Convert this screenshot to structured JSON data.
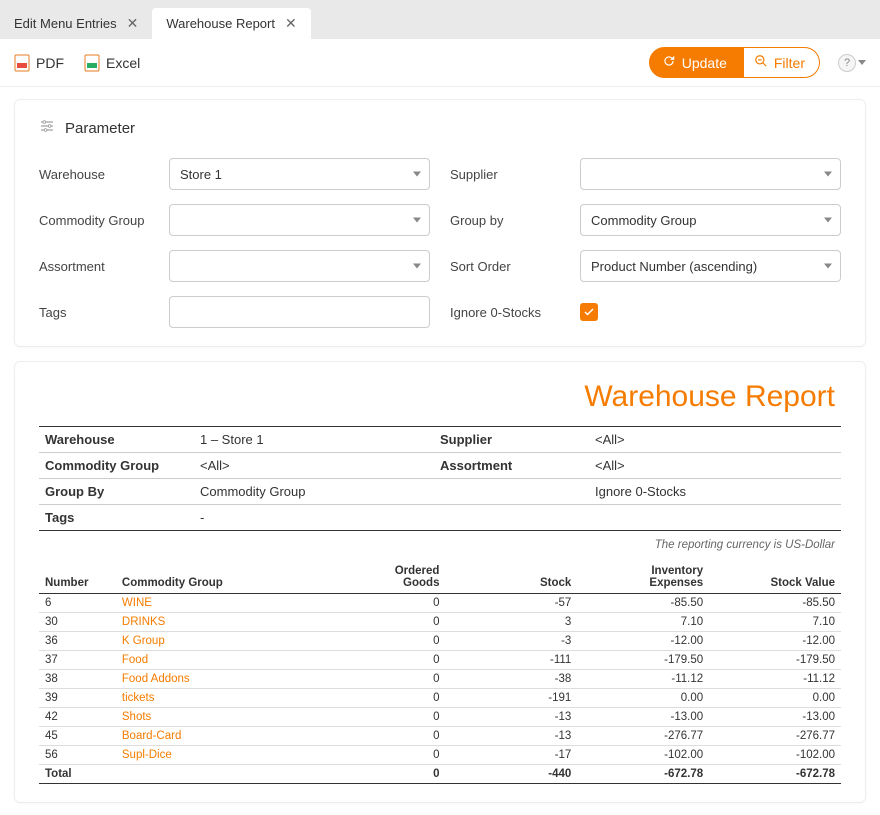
{
  "tabs": [
    {
      "label": "Edit Menu Entries",
      "active": false
    },
    {
      "label": "Warehouse Report",
      "active": true
    }
  ],
  "toolbar": {
    "pdf": "PDF",
    "excel": "Excel",
    "update": "Update",
    "filter": "Filter",
    "help": "?"
  },
  "parameter": {
    "header": "Parameter",
    "labels": {
      "warehouse": "Warehouse",
      "supplier": "Supplier",
      "commodity_group": "Commodity Group",
      "group_by": "Group by",
      "assortment": "Assortment",
      "sort_order": "Sort Order",
      "tags": "Tags",
      "ignore_zero": "Ignore 0-Stocks"
    },
    "values": {
      "warehouse": "Store 1",
      "supplier": "",
      "commodity_group": "",
      "group_by": "Commodity Group",
      "assortment": "",
      "sort_order": "Product Number (ascending)",
      "tags": "",
      "ignore_zero": true
    }
  },
  "report": {
    "title": "Warehouse Report",
    "meta": {
      "warehouse_label": "Warehouse",
      "warehouse_value": "1 – Store 1",
      "supplier_label": "Supplier",
      "supplier_value": "<All>",
      "cg_label": "Commodity Group",
      "cg_value": "<All>",
      "assort_label": "Assortment",
      "assort_value": "<All>",
      "groupby_label": "Group By",
      "groupby_value": "Commodity Group",
      "ignore_label": "",
      "ignore_value": "Ignore 0-Stocks",
      "tags_label": "Tags",
      "tags_value": "-"
    },
    "currency_note": "The reporting currency is US-Dollar",
    "columns": {
      "number": "Number",
      "cg": "Commodity Group",
      "ordered1": "Ordered",
      "ordered2": "Goods",
      "stock": "Stock",
      "inv1": "Inventory",
      "inv2": "Expenses",
      "stock_value": "Stock Value"
    },
    "rows": [
      {
        "number": "6",
        "cg": "WINE",
        "ordered": "0",
        "stock": "-57",
        "inv": "-85.50",
        "sv": "-85.50"
      },
      {
        "number": "30",
        "cg": "DRINKS",
        "ordered": "0",
        "stock": "3",
        "inv": "7.10",
        "sv": "7.10"
      },
      {
        "number": "36",
        "cg": "K Group",
        "ordered": "0",
        "stock": "-3",
        "inv": "-12.00",
        "sv": "-12.00"
      },
      {
        "number": "37",
        "cg": "Food",
        "ordered": "0",
        "stock": "-111",
        "inv": "-179.50",
        "sv": "-179.50"
      },
      {
        "number": "38",
        "cg": "Food Addons",
        "ordered": "0",
        "stock": "-38",
        "inv": "-11.12",
        "sv": "-11.12"
      },
      {
        "number": "39",
        "cg": "tickets",
        "ordered": "0",
        "stock": "-191",
        "inv": "0.00",
        "sv": "0.00"
      },
      {
        "number": "42",
        "cg": "Shots",
        "ordered": "0",
        "stock": "-13",
        "inv": "-13.00",
        "sv": "-13.00"
      },
      {
        "number": "45",
        "cg": "Board-Card",
        "ordered": "0",
        "stock": "-13",
        "inv": "-276.77",
        "sv": "-276.77"
      },
      {
        "number": "56",
        "cg": "Supl-Dice",
        "ordered": "0",
        "stock": "-17",
        "inv": "-102.00",
        "sv": "-102.00"
      }
    ],
    "total": {
      "label": "Total",
      "ordered": "0",
      "stock": "-440",
      "inv": "-672.78",
      "sv": "-672.78"
    }
  }
}
